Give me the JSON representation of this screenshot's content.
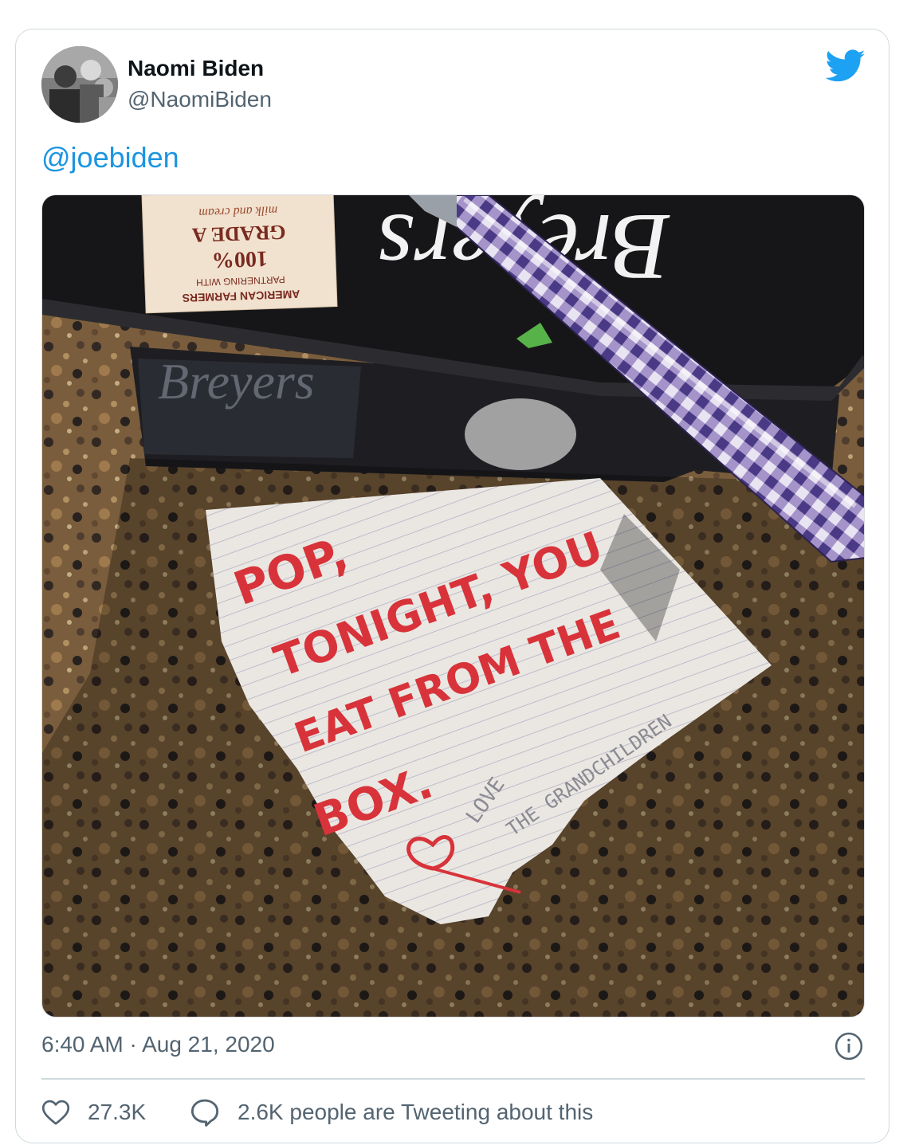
{
  "author": {
    "name": "Naomi Biden",
    "handle": "@NaomiBiden"
  },
  "tweet": {
    "text": "@joebiden",
    "timestamp": "6:40 AM · Aug 21, 2020"
  },
  "photo": {
    "container_lid_brand": "Breyers",
    "container_side_brand": "Breyers",
    "label_lines": [
      "100%",
      "GRADE A",
      "milk and cream",
      "PARTNERING WITH",
      "AMERICAN FARMERS"
    ],
    "note_lines": [
      "POP,",
      "TONIGHT, YOU",
      "EAT FROM THE",
      "BOX."
    ],
    "note_signature": [
      "LOVE",
      "THE GRANDCHILDREN"
    ]
  },
  "stats": {
    "likes": "27.3K",
    "replies": "2.6K people are Tweeting about this"
  },
  "colors": {
    "link": "#1b95e0",
    "twitter_blue": "#1da1f2",
    "secondary_text": "#536471",
    "note_ink": "#d8333a"
  },
  "icons": {
    "bird": "twitter-bird-icon",
    "info": "info-icon",
    "like": "heart-icon",
    "reply": "speech-bubble-icon"
  }
}
